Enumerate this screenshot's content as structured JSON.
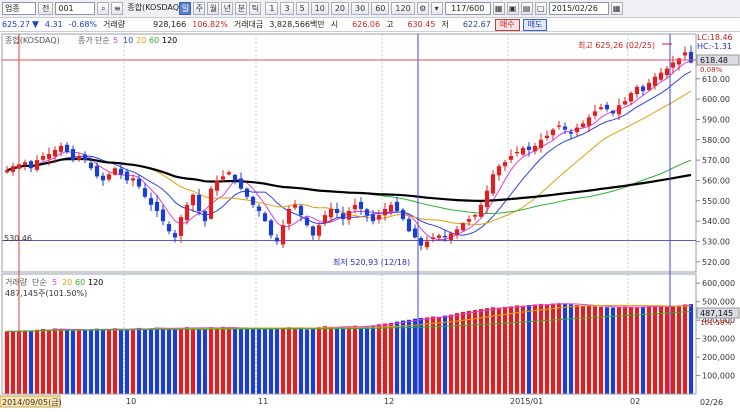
{
  "toolbar": {
    "market_select": "업종",
    "mode_label": "전",
    "code_value": "001",
    "index_name": "종합(KOSDAQ)",
    "period_tabs": [
      {
        "label": "일",
        "selected": true
      },
      {
        "label": "주",
        "selected": false
      },
      {
        "label": "월",
        "selected": false
      },
      {
        "label": "년",
        "selected": false
      },
      {
        "label": "분",
        "selected": false
      },
      {
        "label": "틱",
        "selected": false
      }
    ],
    "interval_buttons": [
      "1",
      "3",
      "5",
      "10",
      "20",
      "30",
      "60",
      "120"
    ],
    "page_counter": "117/600",
    "date_value": "2015/02/26"
  },
  "quote": {
    "price": "625.27",
    "change_arrow": "▼",
    "change": "4.31",
    "change_pct": "-0.68%",
    "volume_label": "거래량",
    "volume": "928,166",
    "volume_ratio": "106.82%",
    "value_label": "거래대금",
    "value": "3,828,566백만",
    "open_label": "시",
    "open": "626.06",
    "high_label": "고",
    "high": "630.45",
    "low_label": "저",
    "low": "622.67",
    "buy_label": "매수",
    "sell_label": "매도"
  },
  "colors": {
    "up": "#e02020",
    "down": "#1a3fd0",
    "ma5": "#e040e0",
    "ma10": "#3040e0",
    "ma20": "#e0a010",
    "ma60": "#30b030",
    "ma120": "#000000",
    "hline": "#5a5ad8"
  },
  "price_panel": {
    "legend_index": "종합(KOSDAQ)",
    "legend_ma": [
      "종가",
      "단순",
      "5",
      "10",
      "20",
      "60",
      "120"
    ],
    "lc_label": "LC:18.46",
    "hc_label": "HC:-1.31",
    "last_price_tag": "618.48",
    "last_change_tag": "0.08%",
    "high_annot": "최고 625,26 (02/25)",
    "low_annot": "최저 520,93 (12/18)",
    "left_level_label": "530.46"
  },
  "volume_panel": {
    "legend": [
      "거래량",
      "단순",
      "5",
      "20",
      "60",
      "120"
    ],
    "value_label": "487,145주(101.50%)",
    "last_tag": "487,145",
    "last_pct_tag": "101.50%"
  },
  "x_axis": {
    "month_labels": [
      "10",
      "11",
      "12",
      "2015/01",
      "02"
    ],
    "cursor_date_tag": "2014/09/05(금)",
    "right_date_tag": "02/26"
  },
  "chart_data": [
    {
      "type": "candlestick",
      "title": "종합(KOSDAQ)",
      "ylim": [
        515,
        632
      ],
      "y_ticks": [
        520,
        530,
        540,
        550,
        560,
        570,
        580,
        590,
        600,
        610
      ],
      "x_month_starts": {
        "10": 20,
        "11": 42,
        "12": 63,
        "2015/01": 84,
        "02": 104
      },
      "closes": [
        565,
        567,
        568,
        569,
        566,
        570,
        572,
        573,
        575,
        577,
        574,
        570,
        572,
        570,
        566,
        562,
        560,
        563,
        566,
        563,
        560,
        561,
        557,
        552,
        548,
        545,
        540,
        535,
        532,
        542,
        548,
        553,
        545,
        540,
        556,
        560,
        562,
        564,
        560,
        556,
        552,
        548,
        545,
        540,
        533,
        530,
        538,
        546,
        548,
        543,
        538,
        533,
        538,
        543,
        546,
        544,
        541,
        545,
        548,
        546,
        543,
        540,
        543,
        546,
        548,
        545,
        541,
        535,
        532,
        528,
        530,
        532,
        533,
        532,
        534,
        536,
        539,
        541,
        543,
        548,
        555,
        563,
        567,
        569,
        572,
        574,
        576,
        575,
        577,
        580,
        582,
        585,
        587,
        585,
        583,
        586,
        588,
        591,
        594,
        596,
        595,
        593,
        597,
        599,
        603,
        606,
        604,
        608,
        611,
        613,
        615,
        618,
        620,
        623,
        618
      ],
      "hline": 530.46,
      "high_marker": {
        "value": 625.26,
        "date": "02/25"
      },
      "low_marker": {
        "value": 520.93,
        "date": "12/18"
      },
      "ma_periods": [
        5,
        10,
        20,
        60,
        120
      ]
    },
    {
      "type": "bar",
      "title": "거래량",
      "ylim": [
        0,
        650000
      ],
      "y_ticks": [
        100000,
        200000,
        300000,
        400000,
        500000,
        600000
      ],
      "y_tick_labels": [
        "100,000",
        "200,000",
        "300,000",
        "400,000",
        "500,000",
        "600,000"
      ],
      "values": [
        340000,
        338000,
        342000,
        345000,
        340000,
        348000,
        352000,
        349000,
        355000,
        353000,
        347000,
        343000,
        351000,
        348000,
        350000,
        354000,
        346000,
        352000,
        356000,
        350000,
        348000,
        355000,
        358000,
        352000,
        356000,
        360000,
        358000,
        352000,
        355000,
        358000,
        362000,
        360000,
        354000,
        356000,
        362000,
        358000,
        364000,
        360000,
        356000,
        352000,
        358000,
        355000,
        360000,
        356000,
        352000,
        355000,
        360000,
        362000,
        358000,
        356000,
        350000,
        355000,
        362000,
        367000,
        364000,
        360000,
        363000,
        366000,
        370000,
        365000,
        368000,
        372000,
        378000,
        382000,
        385000,
        392000,
        398000,
        402000,
        408000,
        412000,
        415000,
        420000,
        418000,
        425000,
        430000,
        438000,
        445000,
        450000,
        455000,
        460000,
        465000,
        470000,
        468000,
        472000,
        475000,
        480000,
        478000,
        482000,
        485000,
        488000,
        486000,
        490000,
        492000,
        488000,
        485000,
        482000,
        478000,
        480000,
        475000,
        472000,
        470000,
        468000,
        472000,
        475000,
        470000,
        468000,
        472000,
        476000,
        478000,
        475000,
        472000,
        478000,
        480000,
        485000,
        487145
      ]
    }
  ]
}
